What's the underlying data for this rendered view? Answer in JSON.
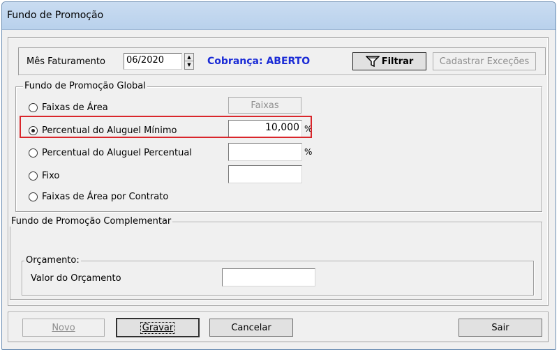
{
  "window": {
    "title": "Fundo de Promoção"
  },
  "top": {
    "mes_label": "Mês Faturamento",
    "mes_value": "06/2020",
    "cobranca": "Cobrança: ABERTO",
    "cobranca_color": "#1a2bd6",
    "filtrar_label": "Filtrar",
    "cadastrar_label": "Cadastrar Exceções"
  },
  "global": {
    "legend": "Fundo de Promoção Global",
    "faixas_button": "Faixas",
    "options": [
      {
        "label": "Faixas de Área",
        "checked": false
      },
      {
        "label": "Percentual do Aluguel Mínimo",
        "checked": true
      },
      {
        "label": "Percentual do Aluguel Percentual",
        "checked": false
      },
      {
        "label": "Fixo",
        "checked": false
      },
      {
        "label": "Faixas de Área por Contrato",
        "checked": false
      }
    ],
    "percent_minimo_value": "10,000",
    "percent_sign": "%",
    "percent_percentual_value": "",
    "fixo_value": ""
  },
  "complementar": {
    "legend": "Fundo de Promoção Complementar",
    "orcamento_legend": "Orçamento:",
    "valor_label": "Valor do Orçamento",
    "valor_value": ""
  },
  "buttons": {
    "novo": "Novo",
    "gravar": "Gravar",
    "cancelar": "Cancelar",
    "sair": "Sair"
  },
  "colors": {
    "highlight": "#d9262b"
  }
}
